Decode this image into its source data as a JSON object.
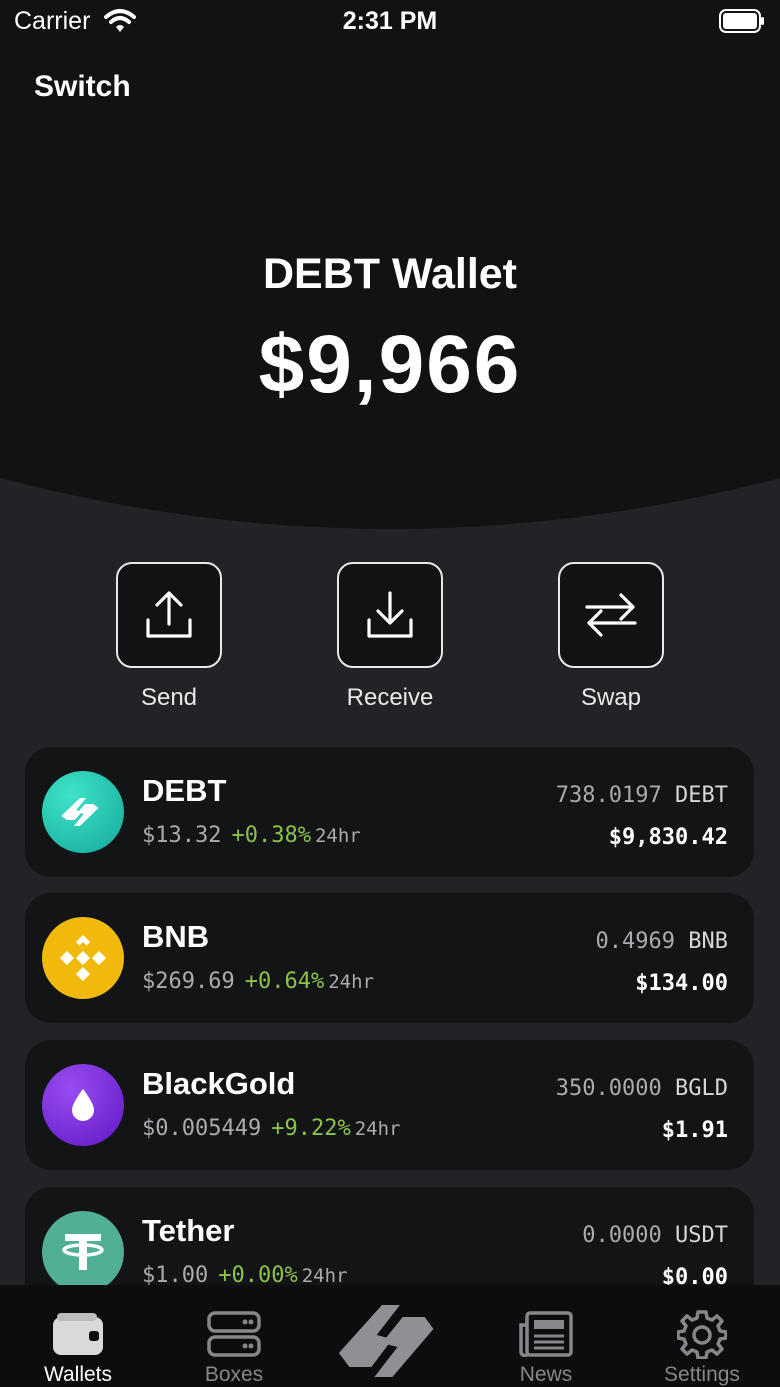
{
  "status_bar": {
    "carrier": "Carrier",
    "time": "2:31 PM"
  },
  "header": {
    "switch_label": "Switch",
    "wallet_name": "DEBT Wallet",
    "total_balance": "$9,966"
  },
  "actions": [
    {
      "label": "Send",
      "icon": "upload-icon"
    },
    {
      "label": "Receive",
      "icon": "download-icon"
    },
    {
      "label": "Swap",
      "icon": "swap-arrows-icon"
    }
  ],
  "assets": [
    {
      "name": "DEBT",
      "price": "$13.32",
      "change": "+0.38%",
      "period": "24hr",
      "amount": "738.0197",
      "symbol": "DEBT",
      "value": "$9,830.42",
      "color": "#1fc8b0"
    },
    {
      "name": "BNB",
      "price": "$269.69",
      "change": "+0.64%",
      "period": "24hr",
      "amount": "0.4969",
      "symbol": "BNB",
      "value": "$134.00",
      "color": "#f0b90b"
    },
    {
      "name": "BlackGold",
      "price": "$0.005449",
      "change": "+9.22%",
      "period": "24hr",
      "amount": "350.0000",
      "symbol": "BGLD",
      "value": "$1.91",
      "color": "#7b2fe0"
    },
    {
      "name": "Tether",
      "price": "$1.00",
      "change": "+0.00%",
      "period": "24hr",
      "amount": "0.0000",
      "symbol": "USDT",
      "value": "$0.00",
      "color": "#50af95"
    }
  ],
  "tabbar": {
    "tabs": [
      {
        "label": "Wallets",
        "icon": "wallet-icon",
        "active": true
      },
      {
        "label": "Boxes",
        "icon": "server-icon",
        "active": false
      },
      {
        "label": "",
        "icon": "debt-logo-icon",
        "active": false
      },
      {
        "label": "News",
        "icon": "newspaper-icon",
        "active": false
      },
      {
        "label": "Settings",
        "icon": "gear-icon",
        "active": false
      }
    ]
  },
  "colors": {
    "background": "#222326",
    "header": "#111214",
    "positive": "#8bc34a"
  }
}
